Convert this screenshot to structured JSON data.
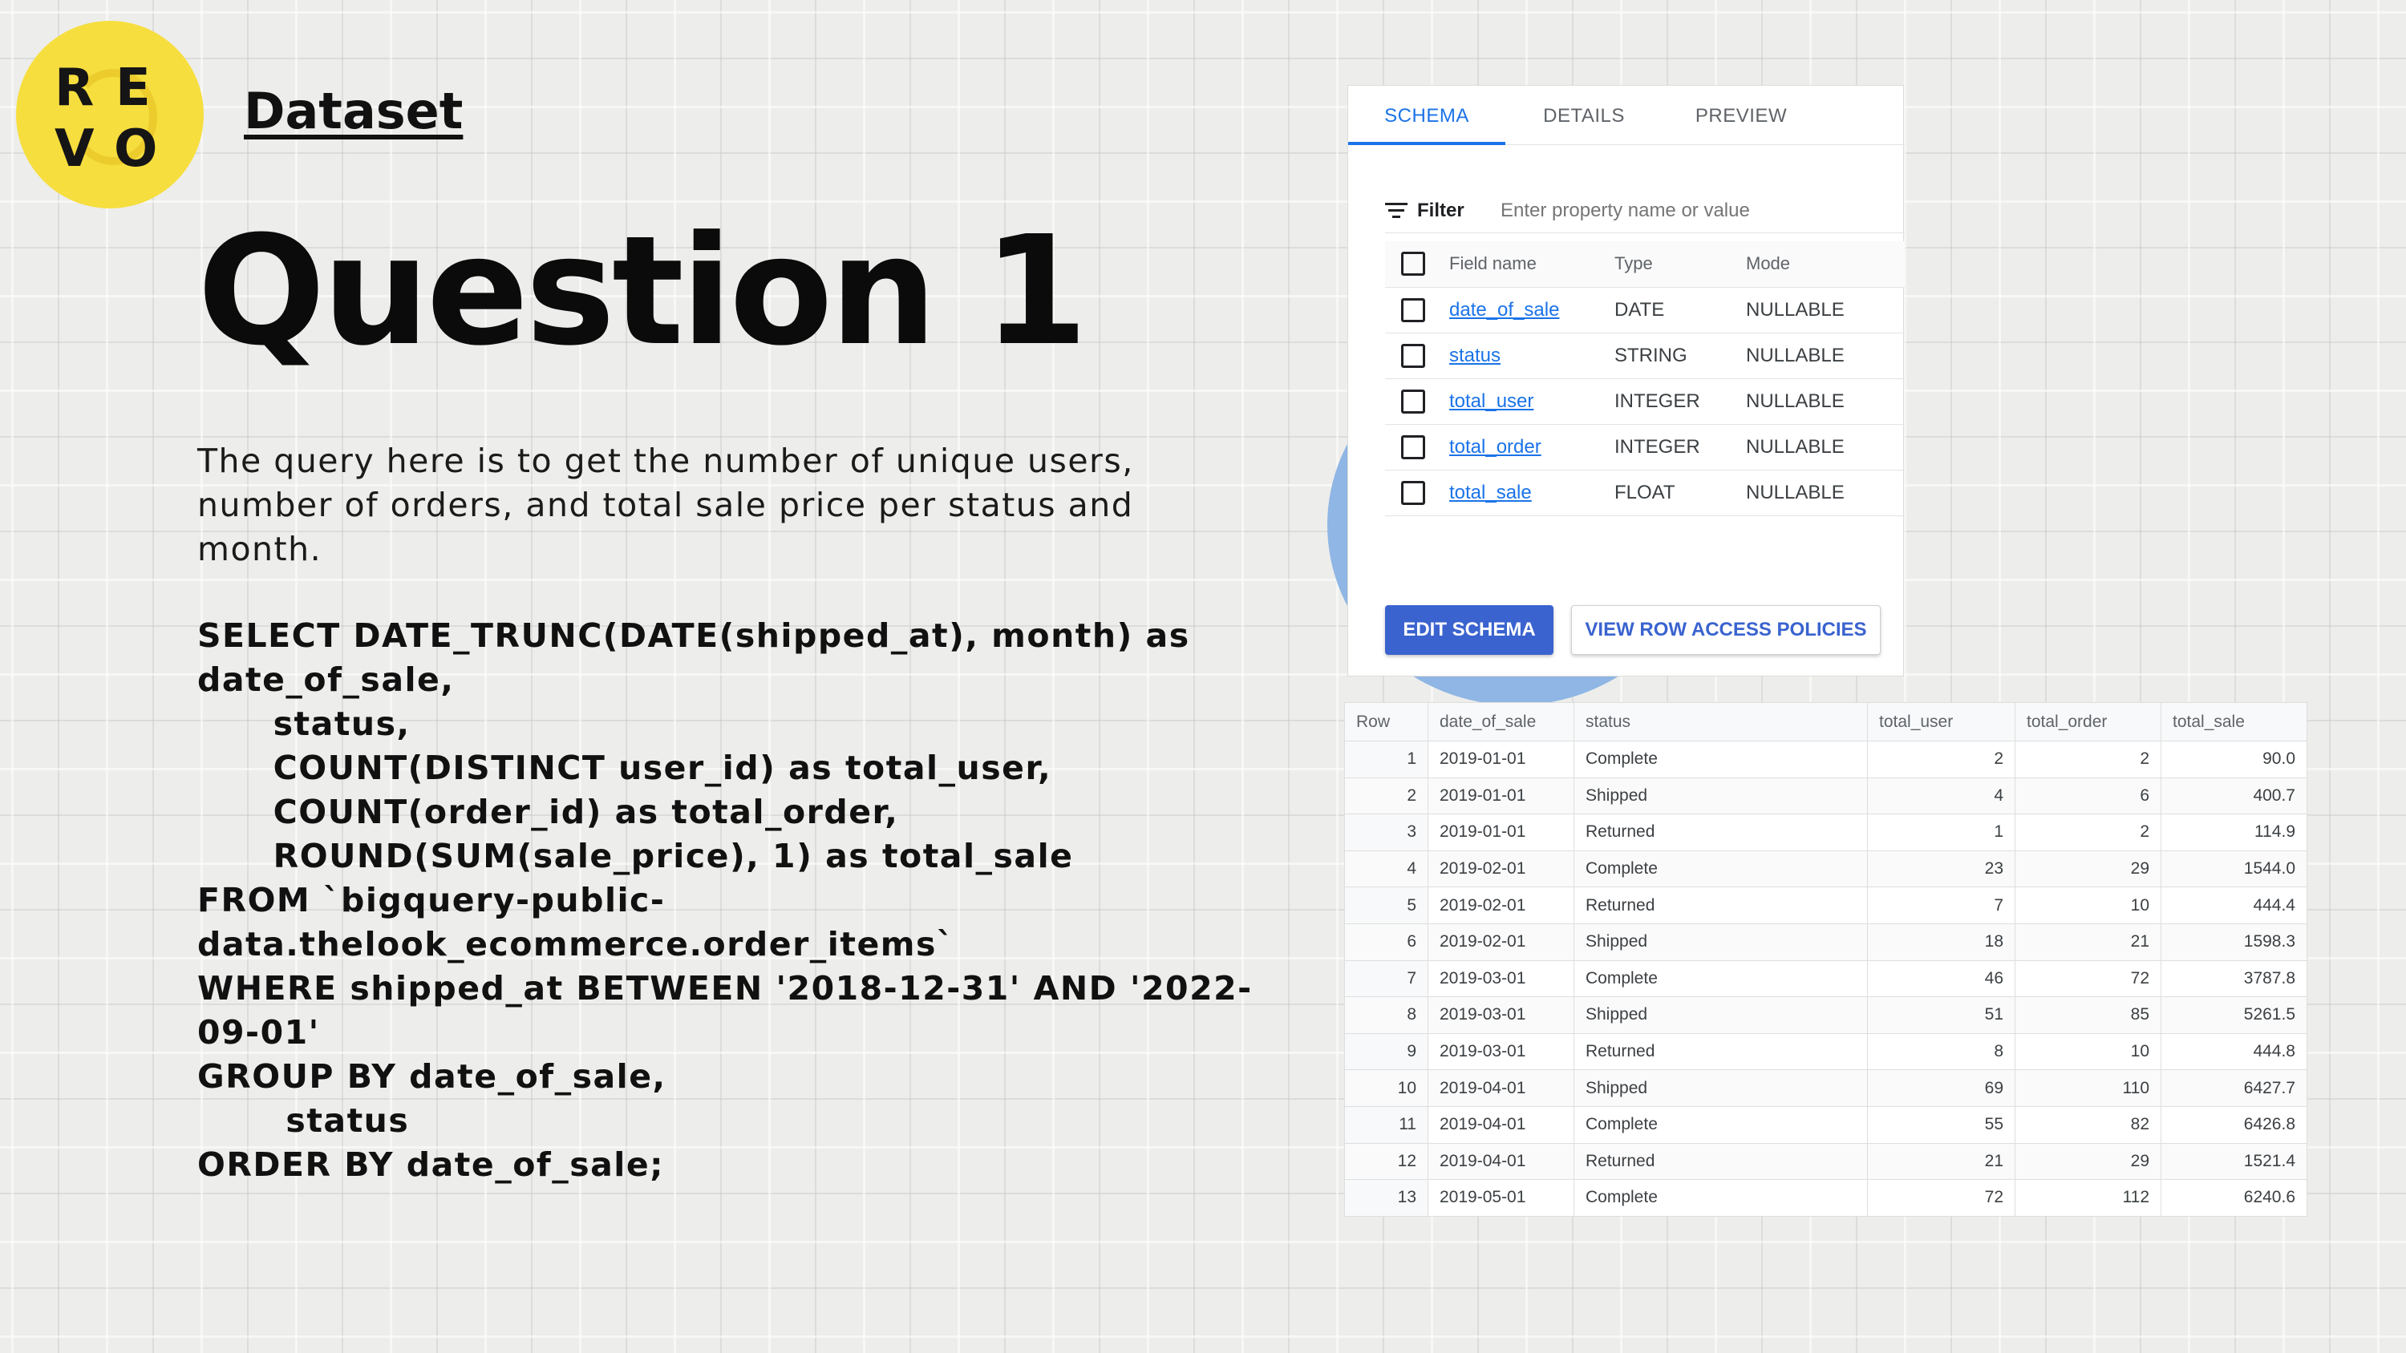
{
  "logo": {
    "letters": [
      "R",
      "E",
      "V",
      "O"
    ],
    "color": "#f6de3f"
  },
  "header": {
    "dataset_link": "Dataset",
    "title": "Question 1"
  },
  "description": [
    "The query here is to get the number of unique users,",
    "number of orders, and total sale price per status and",
    "month."
  ],
  "sql_lines": [
    "SELECT DATE_TRUNC(DATE(shipped_at), month) as",
    "date_of_sale,",
    "      status,",
    "      COUNT(DISTINCT user_id) as total_user,",
    "      COUNT(order_id) as total_order,",
    "      ROUND(SUM(sale_price), 1) as total_sale",
    "FROM `bigquery-public-",
    "data.thelook_ecommerce.order_items`",
    "WHERE shipped_at BETWEEN '2018-12-31' AND '2022-",
    "09-01'",
    "GROUP BY date_of_sale,",
    "       status",
    "ORDER BY date_of_sale;"
  ],
  "schema_panel": {
    "tabs": [
      "SCHEMA",
      "DETAILS",
      "PREVIEW"
    ],
    "active_tab": "SCHEMA",
    "filter_label": "Filter",
    "filter_placeholder": "Enter property name or value",
    "columns": [
      "Field name",
      "Type",
      "Mode"
    ],
    "fields": [
      {
        "name": "date_of_sale",
        "type": "DATE",
        "mode": "NULLABLE"
      },
      {
        "name": "status",
        "type": "STRING",
        "mode": "NULLABLE"
      },
      {
        "name": "total_user",
        "type": "INTEGER",
        "mode": "NULLABLE"
      },
      {
        "name": "total_order",
        "type": "INTEGER",
        "mode": "NULLABLE"
      },
      {
        "name": "total_sale",
        "type": "FLOAT",
        "mode": "NULLABLE"
      }
    ],
    "edit_button": "EDIT SCHEMA",
    "policies_button": "VIEW ROW ACCESS POLICIES",
    "accent": "#1a73e8"
  },
  "results": {
    "columns": [
      "Row",
      "date_of_sale",
      "status",
      "total_user",
      "total_order",
      "total_sale"
    ],
    "rows": [
      [
        "1",
        "2019-01-01",
        "Complete",
        "2",
        "2",
        "90.0"
      ],
      [
        "2",
        "2019-01-01",
        "Shipped",
        "4",
        "6",
        "400.7"
      ],
      [
        "3",
        "2019-01-01",
        "Returned",
        "1",
        "2",
        "114.9"
      ],
      [
        "4",
        "2019-02-01",
        "Complete",
        "23",
        "29",
        "1544.0"
      ],
      [
        "5",
        "2019-02-01",
        "Returned",
        "7",
        "10",
        "444.4"
      ],
      [
        "6",
        "2019-02-01",
        "Shipped",
        "18",
        "21",
        "1598.3"
      ],
      [
        "7",
        "2019-03-01",
        "Complete",
        "46",
        "72",
        "3787.8"
      ],
      [
        "8",
        "2019-03-01",
        "Shipped",
        "51",
        "85",
        "5261.5"
      ],
      [
        "9",
        "2019-03-01",
        "Returned",
        "8",
        "10",
        "444.8"
      ],
      [
        "10",
        "2019-04-01",
        "Shipped",
        "69",
        "110",
        "6427.7"
      ],
      [
        "11",
        "2019-04-01",
        "Complete",
        "55",
        "82",
        "6426.8"
      ],
      [
        "12",
        "2019-04-01",
        "Returned",
        "21",
        "29",
        "1521.4"
      ],
      [
        "13",
        "2019-05-01",
        "Complete",
        "72",
        "112",
        "6240.6"
      ]
    ]
  }
}
